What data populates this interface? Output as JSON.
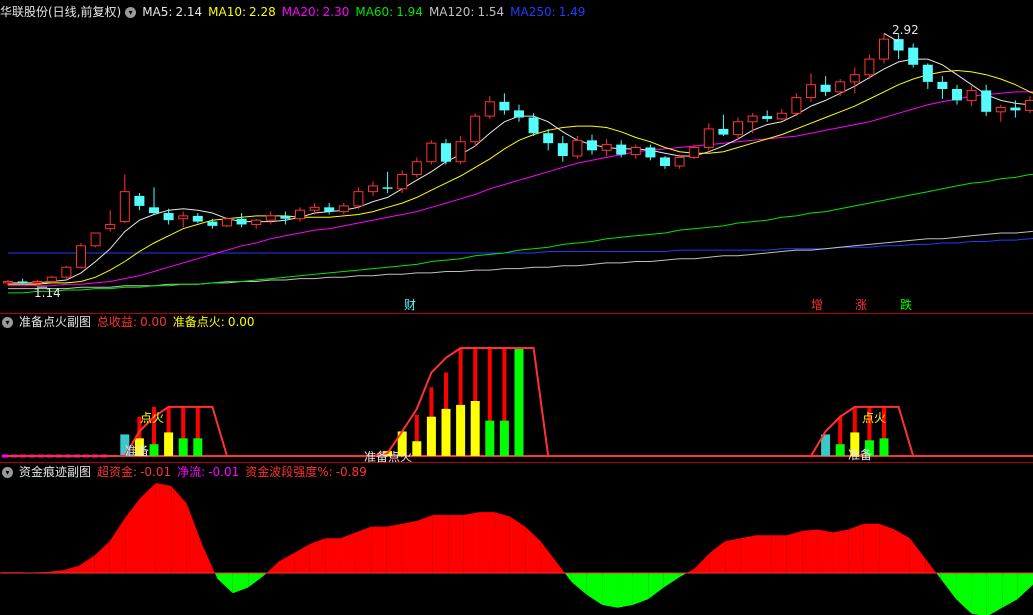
{
  "colors": {
    "bg": "#000000",
    "up": "#ff3232",
    "down": "#54fcfc",
    "ma5": "#e6e6e6",
    "ma10": "#ffff00",
    "ma20": "#ff00ff",
    "ma60": "#00e600",
    "ma120": "#c0c0c0",
    "ma250": "#1f3cff",
    "zero": "#ff3232",
    "panel_line": "#ff3232",
    "fund_pos": "#ff0000",
    "fund_neg": "#00ff00",
    "vol_red": "#ff0000",
    "vol_yellow": "#ffff00",
    "vol_green": "#00ff00",
    "vol_cyan": "#3cc8c8",
    "magenta": "#ff00ff"
  },
  "main_panel": {
    "stock_title": "华联股份(日线,前复权)",
    "indicators": [
      {
        "label": "MA5:",
        "value": "2.14",
        "color": "#e6e6e6"
      },
      {
        "label": "MA10:",
        "value": "2.28",
        "color": "#ffff00"
      },
      {
        "label": "MA20:",
        "value": "2.30",
        "color": "#ff00ff"
      },
      {
        "label": "MA60:",
        "value": "1.94",
        "color": "#00e600"
      },
      {
        "label": "MA120:",
        "value": "1.54",
        "color": "#c0c0c0"
      },
      {
        "label": "MA250:",
        "value": "1.49",
        "color": "#1f3cff"
      }
    ],
    "high_label": "2.92",
    "low_label": "1.14",
    "event_markers": [
      {
        "text": "财",
        "color": "#54fcfc"
      },
      {
        "text": "增",
        "color": "#ff3232"
      },
      {
        "text": "涨",
        "color": "#ff3232"
      },
      {
        "text": "跌",
        "color": "#00ff00"
      }
    ]
  },
  "sub_panel_1": {
    "title": "准备点火副图",
    "items": [
      {
        "label": "总收益:",
        "value": "0.00",
        "color": "#ff3232"
      },
      {
        "label": "准备点火:",
        "value": "0.00",
        "color": "#ffff00"
      }
    ],
    "labels": {
      "fire": "点火",
      "prepare": "准备",
      "prepare_fire": "准备点火"
    }
  },
  "sub_panel_2": {
    "title": "资金痕迹副图",
    "items": [
      {
        "label": "超资金:",
        "value": "-0.01",
        "color": "#ff3232"
      },
      {
        "label": "净流:",
        "value": "-0.01",
        "color": "#ff00ff"
      },
      {
        "label": "资金波段强度%:",
        "value": "-0.89",
        "color": "#ff3232"
      }
    ]
  },
  "chart_data": {
    "type": "candlestick",
    "y_range": [
      1.05,
      3.0
    ],
    "highest": 2.92,
    "lowest": 1.14,
    "candles": [
      [
        1.17,
        1.19,
        1.15,
        1.18
      ],
      [
        1.18,
        1.2,
        1.16,
        1.17
      ],
      [
        1.17,
        1.19,
        1.14,
        1.18
      ],
      [
        1.18,
        1.22,
        1.17,
        1.21
      ],
      [
        1.21,
        1.29,
        1.2,
        1.28
      ],
      [
        1.28,
        1.45,
        1.27,
        1.43
      ],
      [
        1.43,
        1.52,
        1.42,
        1.52
      ],
      [
        1.55,
        1.68,
        1.53,
        1.58
      ],
      [
        1.6,
        1.93,
        1.59,
        1.81
      ],
      [
        1.78,
        1.8,
        1.68,
        1.71
      ],
      [
        1.7,
        1.84,
        1.65,
        1.66
      ],
      [
        1.66,
        1.69,
        1.58,
        1.61
      ],
      [
        1.62,
        1.67,
        1.56,
        1.64
      ],
      [
        1.64,
        1.66,
        1.59,
        1.6
      ],
      [
        1.6,
        1.62,
        1.55,
        1.57
      ],
      [
        1.57,
        1.63,
        1.56,
        1.62
      ],
      [
        1.62,
        1.66,
        1.56,
        1.58
      ],
      [
        1.58,
        1.62,
        1.55,
        1.61
      ],
      [
        1.61,
        1.67,
        1.58,
        1.64
      ],
      [
        1.64,
        1.67,
        1.58,
        1.62
      ],
      [
        1.62,
        1.7,
        1.6,
        1.68
      ],
      [
        1.68,
        1.73,
        1.65,
        1.7
      ],
      [
        1.7,
        1.73,
        1.65,
        1.67
      ],
      [
        1.67,
        1.73,
        1.65,
        1.71
      ],
      [
        1.71,
        1.84,
        1.69,
        1.81
      ],
      [
        1.81,
        1.88,
        1.78,
        1.85
      ],
      [
        1.84,
        1.95,
        1.8,
        1.83
      ],
      [
        1.83,
        1.96,
        1.8,
        1.93
      ],
      [
        1.93,
        2.05,
        1.91,
        2.02
      ],
      [
        2.02,
        2.17,
        2.0,
        2.15
      ],
      [
        2.15,
        2.18,
        2.0,
        2.02
      ],
      [
        2.02,
        2.2,
        2.0,
        2.16
      ],
      [
        2.16,
        2.36,
        2.13,
        2.34
      ],
      [
        2.34,
        2.48,
        2.32,
        2.44
      ],
      [
        2.44,
        2.5,
        2.35,
        2.38
      ],
      [
        2.38,
        2.42,
        2.3,
        2.33
      ],
      [
        2.33,
        2.36,
        2.2,
        2.22
      ],
      [
        2.22,
        2.25,
        2.1,
        2.15
      ],
      [
        2.15,
        2.2,
        2.02,
        2.06
      ],
      [
        2.06,
        2.2,
        2.04,
        2.17
      ],
      [
        2.17,
        2.21,
        2.07,
        2.1
      ],
      [
        2.1,
        2.18,
        2.06,
        2.14
      ],
      [
        2.14,
        2.17,
        2.05,
        2.07
      ],
      [
        2.07,
        2.14,
        2.04,
        2.12
      ],
      [
        2.12,
        2.14,
        2.03,
        2.05
      ],
      [
        2.05,
        2.06,
        1.97,
        1.99
      ],
      [
        1.99,
        2.07,
        1.97,
        2.05
      ],
      [
        2.05,
        2.14,
        2.04,
        2.12
      ],
      [
        2.12,
        2.29,
        2.1,
        2.25
      ],
      [
        2.25,
        2.35,
        2.2,
        2.21
      ],
      [
        2.21,
        2.33,
        2.18,
        2.3
      ],
      [
        2.3,
        2.36,
        2.22,
        2.34
      ],
      [
        2.34,
        2.38,
        2.3,
        2.32
      ],
      [
        2.32,
        2.39,
        2.31,
        2.36
      ],
      [
        2.36,
        2.5,
        2.34,
        2.47
      ],
      [
        2.47,
        2.64,
        2.44,
        2.56
      ],
      [
        2.56,
        2.62,
        2.48,
        2.51
      ],
      [
        2.51,
        2.6,
        2.48,
        2.58
      ],
      [
        2.58,
        2.68,
        2.5,
        2.63
      ],
      [
        2.63,
        2.77,
        2.6,
        2.74
      ],
      [
        2.74,
        2.92,
        2.71,
        2.88
      ],
      [
        2.88,
        2.92,
        2.74,
        2.8
      ],
      [
        2.82,
        2.85,
        2.68,
        2.7
      ],
      [
        2.7,
        2.71,
        2.53,
        2.58
      ],
      [
        2.58,
        2.62,
        2.46,
        2.53
      ],
      [
        2.53,
        2.56,
        2.42,
        2.45
      ],
      [
        2.45,
        2.55,
        2.41,
        2.52
      ],
      [
        2.52,
        2.56,
        2.34,
        2.37
      ],
      [
        2.37,
        2.42,
        2.3,
        2.4
      ],
      [
        2.4,
        2.45,
        2.33,
        2.38
      ],
      [
        2.38,
        2.48,
        2.36,
        2.45
      ],
      [
        2.45,
        2.55,
        2.42,
        2.5
      ]
    ],
    "ma5": [
      1.17,
      1.17,
      1.17,
      1.18,
      1.19,
      1.24,
      1.32,
      1.41,
      1.53,
      1.61,
      1.65,
      1.68,
      1.69,
      1.68,
      1.66,
      1.62,
      1.6,
      1.6,
      1.6,
      1.61,
      1.63,
      1.66,
      1.67,
      1.68,
      1.7,
      1.74,
      1.77,
      1.83,
      1.89,
      1.95,
      2.02,
      2.07,
      2.13,
      2.22,
      2.3,
      2.34,
      2.34,
      2.3,
      2.23,
      2.17,
      2.14,
      2.12,
      2.11,
      2.11,
      2.1,
      2.08,
      2.06,
      2.06,
      2.09,
      2.13,
      2.18,
      2.24,
      2.28,
      2.3,
      2.35,
      2.41,
      2.45,
      2.5,
      2.55,
      2.61,
      2.67,
      2.72,
      2.74,
      2.74,
      2.7,
      2.63,
      2.56,
      2.49,
      2.45,
      2.43,
      2.42,
      2.42
    ],
    "ma10": [
      1.16,
      1.16,
      1.16,
      1.17,
      1.17,
      1.18,
      1.21,
      1.26,
      1.32,
      1.39,
      1.45,
      1.5,
      1.55,
      1.58,
      1.61,
      1.62,
      1.63,
      1.64,
      1.64,
      1.64,
      1.63,
      1.63,
      1.63,
      1.64,
      1.65,
      1.67,
      1.7,
      1.73,
      1.77,
      1.82,
      1.87,
      1.92,
      1.98,
      2.04,
      2.11,
      2.17,
      2.21,
      2.24,
      2.26,
      2.27,
      2.27,
      2.26,
      2.23,
      2.19,
      2.16,
      2.12,
      2.09,
      2.08,
      2.08,
      2.09,
      2.12,
      2.15,
      2.18,
      2.21,
      2.25,
      2.29,
      2.33,
      2.37,
      2.41,
      2.46,
      2.51,
      2.56,
      2.6,
      2.63,
      2.65,
      2.66,
      2.65,
      2.63,
      2.6,
      2.56,
      2.51,
      2.47
    ],
    "ma20": [
      1.15,
      1.15,
      1.15,
      1.15,
      1.16,
      1.16,
      1.17,
      1.18,
      1.2,
      1.22,
      1.25,
      1.28,
      1.31,
      1.34,
      1.37,
      1.4,
      1.43,
      1.45,
      1.48,
      1.5,
      1.52,
      1.54,
      1.55,
      1.57,
      1.59,
      1.61,
      1.63,
      1.65,
      1.67,
      1.7,
      1.73,
      1.76,
      1.79,
      1.83,
      1.86,
      1.89,
      1.92,
      1.95,
      1.98,
      2.01,
      2.03,
      2.05,
      2.07,
      2.09,
      2.1,
      2.11,
      2.12,
      2.13,
      2.14,
      2.15,
      2.16,
      2.17,
      2.18,
      2.19,
      2.2,
      2.22,
      2.24,
      2.26,
      2.28,
      2.3,
      2.33,
      2.36,
      2.39,
      2.42,
      2.44,
      2.46,
      2.48,
      2.49,
      2.5,
      2.51,
      2.51,
      2.52
    ],
    "ma60": [
      1.1,
      1.1,
      1.11,
      1.11,
      1.12,
      1.12,
      1.13,
      1.13,
      1.14,
      1.14,
      1.15,
      1.15,
      1.16,
      1.16,
      1.17,
      1.18,
      1.18,
      1.19,
      1.2,
      1.21,
      1.22,
      1.23,
      1.24,
      1.25,
      1.26,
      1.27,
      1.28,
      1.29,
      1.3,
      1.32,
      1.33,
      1.34,
      1.36,
      1.37,
      1.38,
      1.4,
      1.41,
      1.42,
      1.44,
      1.45,
      1.46,
      1.48,
      1.49,
      1.5,
      1.51,
      1.52,
      1.54,
      1.55,
      1.56,
      1.57,
      1.59,
      1.6,
      1.61,
      1.63,
      1.64,
      1.66,
      1.67,
      1.69,
      1.71,
      1.73,
      1.75,
      1.77,
      1.79,
      1.81,
      1.83,
      1.85,
      1.87,
      1.88,
      1.9,
      1.91,
      1.93,
      1.94
    ],
    "ma120": [
      1.13,
      1.13,
      1.13,
      1.13,
      1.13,
      1.14,
      1.14,
      1.14,
      1.15,
      1.15,
      1.15,
      1.16,
      1.16,
      1.16,
      1.17,
      1.17,
      1.18,
      1.18,
      1.19,
      1.19,
      1.2,
      1.2,
      1.21,
      1.21,
      1.22,
      1.22,
      1.23,
      1.23,
      1.24,
      1.24,
      1.25,
      1.25,
      1.26,
      1.26,
      1.27,
      1.27,
      1.28,
      1.28,
      1.29,
      1.29,
      1.3,
      1.31,
      1.31,
      1.32,
      1.32,
      1.33,
      1.34,
      1.34,
      1.35,
      1.36,
      1.36,
      1.37,
      1.38,
      1.39,
      1.4,
      1.4,
      1.41,
      1.42,
      1.43,
      1.44,
      1.45,
      1.46,
      1.47,
      1.48,
      1.48,
      1.49,
      1.5,
      1.51,
      1.52,
      1.52,
      1.53,
      1.54
    ],
    "ma250": [
      1.38,
      1.38,
      1.38,
      1.38,
      1.38,
      1.38,
      1.38,
      1.38,
      1.38,
      1.38,
      1.38,
      1.38,
      1.38,
      1.38,
      1.38,
      1.38,
      1.38,
      1.38,
      1.38,
      1.38,
      1.38,
      1.38,
      1.38,
      1.38,
      1.38,
      1.38,
      1.38,
      1.38,
      1.38,
      1.38,
      1.38,
      1.38,
      1.38,
      1.38,
      1.38,
      1.38,
      1.38,
      1.39,
      1.39,
      1.39,
      1.39,
      1.39,
      1.39,
      1.39,
      1.39,
      1.39,
      1.4,
      1.4,
      1.4,
      1.4,
      1.4,
      1.4,
      1.4,
      1.41,
      1.41,
      1.41,
      1.41,
      1.42,
      1.42,
      1.42,
      1.43,
      1.43,
      1.44,
      1.44,
      1.45,
      1.45,
      1.46,
      1.46,
      1.47,
      1.47,
      1.48,
      1.49
    ],
    "fire_line": [
      0,
      0,
      0,
      0,
      0,
      0,
      0,
      0,
      0,
      0,
      0,
      0,
      0,
      0,
      0,
      0,
      0,
      0,
      0,
      0,
      0,
      0,
      0,
      0,
      0,
      0,
      0,
      0,
      0,
      0,
      0,
      0,
      0,
      0,
      0,
      0,
      0,
      0,
      0,
      0,
      0,
      0,
      0,
      0,
      0,
      0,
      0,
      0,
      0,
      0,
      0,
      0,
      0,
      0,
      0,
      0,
      0,
      0,
      0,
      0,
      0,
      0,
      0,
      0,
      0,
      0,
      0,
      0,
      0,
      0,
      0,
      0
    ],
    "fire_bars": [
      {
        "i": 8,
        "v": 22,
        "c": "cyan"
      },
      {
        "i": 9,
        "v": 40,
        "c": "red"
      },
      {
        "i": 9,
        "v": 18,
        "c": "yellow"
      },
      {
        "i": 10,
        "v": 50,
        "c": "red"
      },
      {
        "i": 10,
        "v": 12,
        "c": "green"
      },
      {
        "i": 11,
        "v": 50,
        "c": "red"
      },
      {
        "i": 11,
        "v": 24,
        "c": "yellow"
      },
      {
        "i": 12,
        "v": 50,
        "c": "red"
      },
      {
        "i": 12,
        "v": 18,
        "c": "green"
      },
      {
        "i": 13,
        "v": 50,
        "c": "red"
      },
      {
        "i": 13,
        "v": 18,
        "c": "green"
      },
      {
        "i": 26,
        "v": 5,
        "c": "yellow"
      },
      {
        "i": 27,
        "v": 25,
        "c": "red"
      },
      {
        "i": 27,
        "v": 25,
        "c": "yellow"
      },
      {
        "i": 28,
        "v": 42,
        "c": "red"
      },
      {
        "i": 28,
        "v": 15,
        "c": "yellow"
      },
      {
        "i": 29,
        "v": 70,
        "c": "red"
      },
      {
        "i": 29,
        "v": 40,
        "c": "yellow"
      },
      {
        "i": 30,
        "v": 85,
        "c": "red"
      },
      {
        "i": 30,
        "v": 48,
        "c": "yellow"
      },
      {
        "i": 31,
        "v": 110,
        "c": "red"
      },
      {
        "i": 31,
        "v": 52,
        "c": "yellow"
      },
      {
        "i": 32,
        "v": 110,
        "c": "red"
      },
      {
        "i": 32,
        "v": 56,
        "c": "yellow"
      },
      {
        "i": 33,
        "v": 110,
        "c": "red"
      },
      {
        "i": 33,
        "v": 36,
        "c": "green"
      },
      {
        "i": 34,
        "v": 110,
        "c": "red"
      },
      {
        "i": 34,
        "v": 36,
        "c": "green"
      },
      {
        "i": 35,
        "v": 110,
        "c": "green"
      },
      {
        "i": 56,
        "v": 22,
        "c": "cyan"
      },
      {
        "i": 57,
        "v": 40,
        "c": "red"
      },
      {
        "i": 57,
        "v": 12,
        "c": "green"
      },
      {
        "i": 58,
        "v": 50,
        "c": "red"
      },
      {
        "i": 58,
        "v": 24,
        "c": "yellow"
      },
      {
        "i": 59,
        "v": 50,
        "c": "red"
      },
      {
        "i": 59,
        "v": 16,
        "c": "green"
      },
      {
        "i": 60,
        "v": 50,
        "c": "red"
      },
      {
        "i": 60,
        "v": 18,
        "c": "green"
      }
    ],
    "fire_envelope": [
      0,
      0,
      0,
      0,
      0,
      0,
      0,
      0,
      0,
      25,
      40,
      50,
      50,
      50,
      50,
      0,
      0,
      0,
      0,
      0,
      0,
      0,
      0,
      0,
      0,
      0,
      3,
      25,
      48,
      85,
      100,
      110,
      110,
      110,
      110,
      110,
      110,
      0,
      0,
      0,
      0,
      0,
      0,
      0,
      0,
      0,
      0,
      0,
      0,
      0,
      0,
      0,
      0,
      0,
      0,
      0,
      25,
      40,
      50,
      50,
      50,
      50,
      0,
      0,
      0,
      0,
      0,
      0,
      0,
      0,
      0,
      0
    ],
    "fund": [
      0.5,
      0.5,
      0.3,
      0.8,
      2,
      5,
      12,
      22,
      38,
      52,
      62,
      60,
      48,
      20,
      -4,
      -14,
      -10,
      -2,
      8,
      14,
      20,
      24,
      24,
      28,
      32,
      32,
      34,
      36,
      40,
      40,
      40,
      42,
      42,
      39,
      32,
      22,
      8,
      -6,
      -15,
      -22,
      -24,
      -22,
      -18,
      -10,
      -3,
      3,
      14,
      22,
      24,
      26,
      26,
      26,
      29,
      30,
      28,
      30,
      34,
      34,
      30,
      24,
      10,
      -4,
      -18,
      -28,
      -30,
      -24,
      -18,
      -8
    ]
  }
}
